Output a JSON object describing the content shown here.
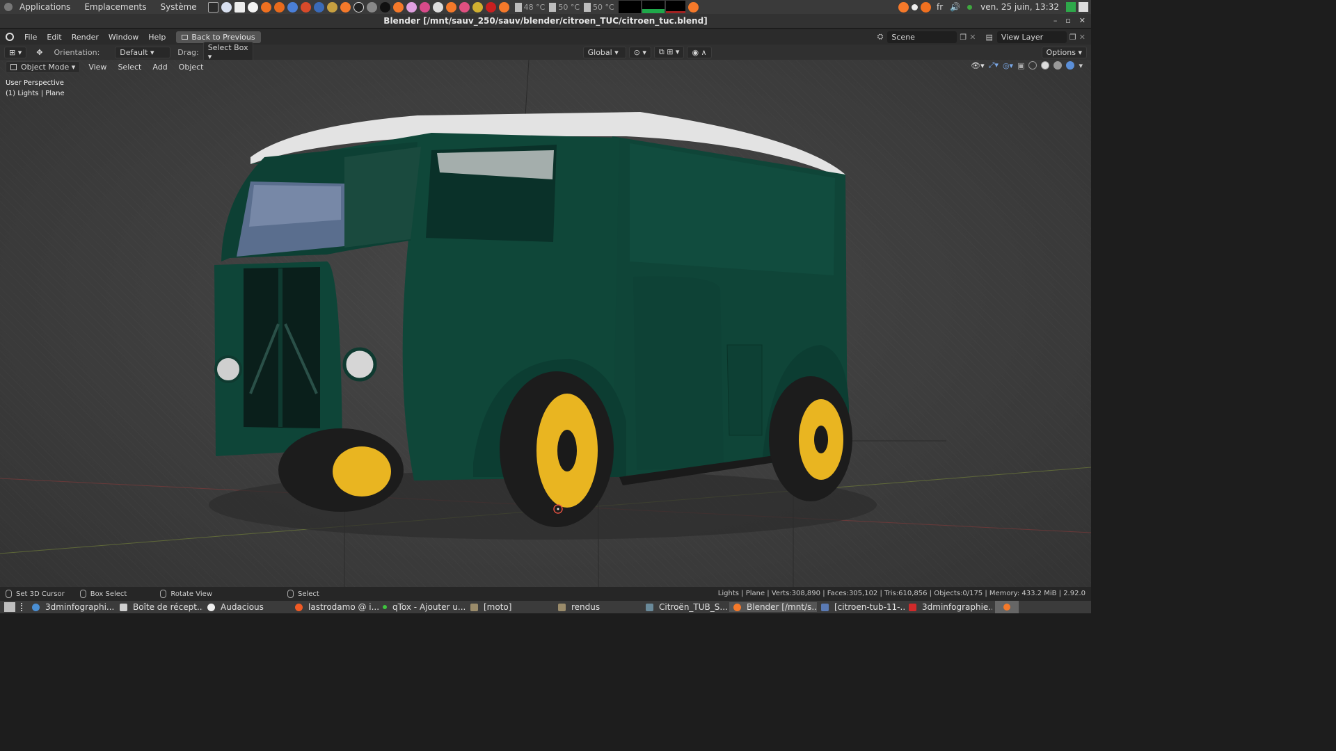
{
  "system_panel": {
    "menus": [
      "Applications",
      "Emplacements",
      "Système"
    ],
    "temps": [
      "48 °C",
      "50 °C",
      "50 °C"
    ],
    "lang": "fr",
    "datetime": "ven. 25 juin, 13:32"
  },
  "window": {
    "title": "Blender [/mnt/sauv_250/sauv/blender/citroen_TUC/citroen_tuc.blend]",
    "controls": [
      "–",
      "▫",
      "✕"
    ]
  },
  "topbar": {
    "menus": [
      "File",
      "Edit",
      "Render",
      "Window",
      "Help"
    ],
    "back_button": "Back to Previous",
    "scene": "Scene",
    "view_layer": "View Layer"
  },
  "tool_header": {
    "orientation_label": "Orientation:",
    "orientation_value": "Default",
    "drag_label": "Drag:",
    "drag_value": "Select Box",
    "transform_orientation": "Global",
    "options": "Options"
  },
  "viewport_header": {
    "mode": "Object Mode",
    "menus": [
      "View",
      "Select",
      "Add",
      "Object"
    ]
  },
  "viewport_info": {
    "perspective": "User Perspective",
    "collection": "(1) Lights | Plane"
  },
  "status_bar": {
    "hints": [
      "Set 3D Cursor",
      "Box Select",
      "Rotate View",
      "Select"
    ],
    "stats": "Lights | Plane | Verts:308,890 | Faces:305,102 | Tris:610,856 | Objects:0/175 | Memory: 433.2 MiB | 2.92.0"
  },
  "taskbar": {
    "tasks": [
      {
        "label": "3dminfographi...",
        "color": "#4a8fd4"
      },
      {
        "label": "Boîte de récept...",
        "color": "#d0d0d0"
      },
      {
        "label": "Audacious",
        "color": "#eeeeee"
      },
      {
        "label": "lastrodamo @ i...",
        "color": "#f05a24"
      },
      {
        "label": "qTox - Ajouter u...",
        "color": "#3ec43e"
      },
      {
        "label": "[moto]",
        "color": "#9a8b6a"
      },
      {
        "label": "rendus",
        "color": "#9a8b6a"
      },
      {
        "label": "Citroën_TUB_S...",
        "color": "#6a8a9a"
      },
      {
        "label": "Blender [/mnt/s...",
        "color": "#f5792a"
      },
      {
        "label": "[citroen-tub-11-...",
        "color": "#5a7ab4"
      },
      {
        "label": "3dminfographie...",
        "color": "#d02a2a"
      }
    ]
  },
  "colors": {
    "van_body": "#114a3c",
    "roof": "#e6e6e6",
    "wheel_rim": "#e9b521",
    "viewport_bg": "#3d3d3d"
  }
}
